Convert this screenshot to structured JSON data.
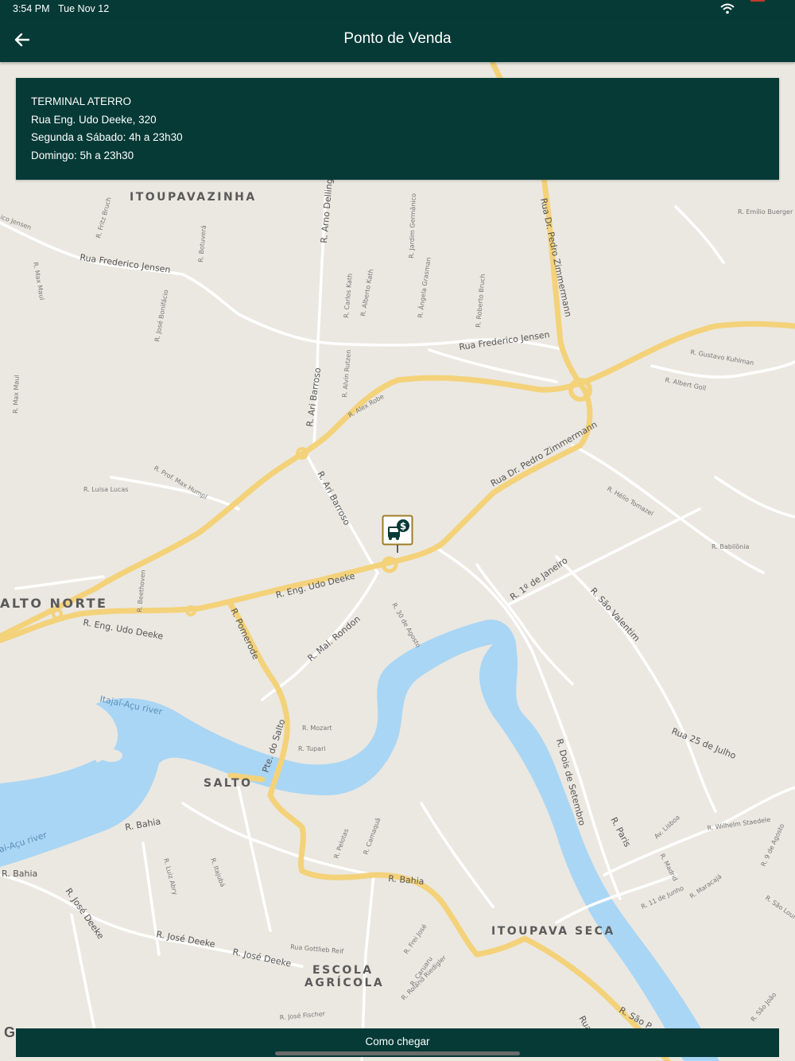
{
  "status_bar": {
    "time": "3:54 PM",
    "date": "Tue Nov 12"
  },
  "app_bar": {
    "title": "Ponto de Venda",
    "back_icon": "arrow-left-icon"
  },
  "info_card": {
    "name": "TERMINAL ATERRO",
    "address": "Rua Eng. Udo Deeke, 320",
    "hours_weekdays": "Segunda a Sábado: 4h a 23h30",
    "hours_sunday": "Domingo: 5h a 23h30"
  },
  "map": {
    "marker_icon": "bus-dollar-icon",
    "district_labels": {
      "itoupavazinha": "ITOUPAVAZINHA",
      "alto_norte": "ALTO NORTE",
      "salto": "SALTO",
      "itoupava_seca": "ITOUPAVA SECA",
      "escola_agricola_1": "ESCOLA",
      "escola_agricola_2": "AGRÍCOLA"
    },
    "river_labels": {
      "itajai_1": "Itajaí-Açu river",
      "itajai_2": "ai-Açu river"
    },
    "street_labels": {
      "udo_deeke_1": "R. Eng. Udo Deeke",
      "udo_deeke_2": "R. Eng. Udo Deeke",
      "pedro_zimmermann_1": "Rua Dr. Pedro Zimmermann",
      "pedro_zimmermann_2": "Rua Dr. Pedro Zimmermann",
      "frederico_jensen_1": "Rua Frederico Jensen",
      "frederico_jensen_2": "Rua Frederico Jensen",
      "pomerode": "R. Pomerode",
      "pte_do_salto": "Pte. do Salto",
      "bahia_1": "R. Bahia",
      "bahia_2": "R. Bahia",
      "bahia_3": "R. Bahia",
      "jose_deeke_1": "R. José Deeke",
      "jose_deeke_2": "R. José Deeke",
      "jose_deeke_3": "R. José Deeke",
      "ari_barroso_1": "R. Ari Barroso",
      "ari_barroso_2": "R. Ari Barroso",
      "mal_rondon": "R. Mal. Rondon",
      "sao_valentim": "R. São Valentim",
      "primeiro_de_janeiro": "R. 1º de Janeiro",
      "dois_de_setembro": "R. Dois de Setembro",
      "rua_25_de_julho": "Rua 25 de Julho",
      "paris": "R. Paris",
      "arno_delling": "R. Arno Delling",
      "sao_paulo": "R. São P",
      "rua_partial": "Rua",
      "wilhelm_staedele": "R. Wilhelm Staedele",
      "babilonia": "R. Babilônia",
      "hein_tomazel": "R. Hélio Tomazel",
      "trinta_de_agosto": "R. 30 de Agosto",
      "mozart": "R. Mozart",
      "tupari": "R. Tupari",
      "maracaja": "R. Maracajá",
      "madrid": "R. Madrid",
      "lisboa": "Av. Lisboa",
      "onze_de_junho": "R. 11 de Junho",
      "nove_de_agosto": "R. 9 de Agosto",
      "sao_lourenco": "R. São Louren",
      "emilio_buerger": "R. Emílio Buerger",
      "gustavo_kuhlman": "R. Gustavo Kuhlman",
      "albert_goll": "R. Albert Goll",
      "alex_robe": "R. Alex Robe",
      "prof_max_humpl": "R. Prof. Max Humpl",
      "luisa_lucas": "R. Luisa Lucas",
      "beethoven": "R. Beethoven",
      "caruaru": "R. Caruaru",
      "roland_riedigler": "R. Roland Riedigler",
      "gottlieb_reif": "Rua Gottlieb Reif",
      "jose_fischer": "R. José Fischer",
      "frei_jose": "R. Frei José",
      "pelotas": "R. Pelotas",
      "camaqua": "R. Camaquã",
      "luiz_abry": "R. Luiz Abry",
      "itajuba": "R. Itajubá",
      "jose_bonifacio": "R. José Bonifácio",
      "alberto_kath": "R. Alberto Kath",
      "carlos_kath": "R. Carlos Kath",
      "roberto_bruch": "R. Roberto Bruch",
      "fritz_bruch": "R. Fritz Bruch",
      "alvin_rutzen": "R. Alvin Rutzen",
      "angela_grasman": "R. Ângela Grasman",
      "jardim_germanico": "R. Jardim Germânico",
      "max_maul_1": "R. Max Maul",
      "max_maul_2": "R. Max Maul",
      "jensen": "ico Jensen",
      "botuvera": "R. Botuverá",
      "sao_joao": "R. São João"
    }
  },
  "cta": {
    "label": "Como chegar"
  }
}
